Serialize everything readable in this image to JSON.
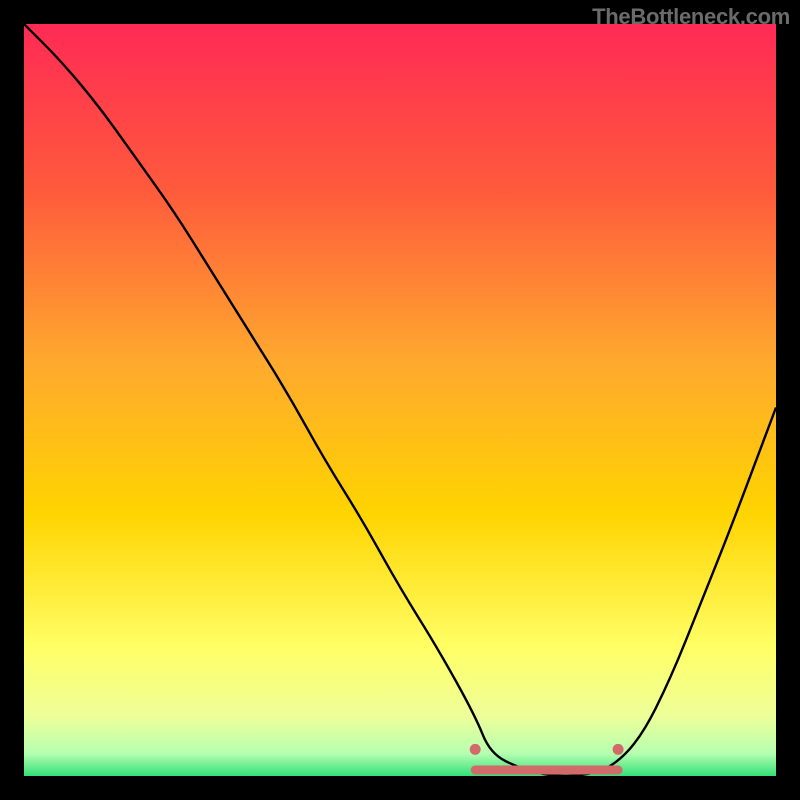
{
  "brand": {
    "watermark": "TheBottleneck.com"
  },
  "colors": {
    "bg": "#000000",
    "gradient_top": "#ff2a55",
    "gradient_mid": "#ffd400",
    "gradient_lowmid": "#ffff66",
    "gradient_bottom": "#33e07a",
    "curve": "#000000",
    "marker": "#d36a6a"
  },
  "chart_data": {
    "type": "line",
    "title": "",
    "xlabel": "",
    "ylabel": "",
    "xlim": [
      0,
      100
    ],
    "ylim": [
      0,
      100
    ],
    "x": [
      0,
      5,
      10,
      15,
      20,
      25,
      30,
      35,
      40,
      45,
      50,
      55,
      60,
      62,
      66,
      70,
      74,
      78,
      82,
      86,
      90,
      94,
      100
    ],
    "values": [
      100,
      95,
      89,
      82,
      75,
      67,
      59,
      51,
      42,
      34,
      25,
      17,
      8,
      3,
      1,
      0,
      0,
      1,
      5,
      13,
      23,
      33,
      49
    ],
    "highlight_range": {
      "x_start": 60,
      "x_end": 79,
      "y": 0
    },
    "highlight_points": [
      {
        "x": 60,
        "y": 3
      },
      {
        "x": 79,
        "y": 3
      }
    ]
  }
}
